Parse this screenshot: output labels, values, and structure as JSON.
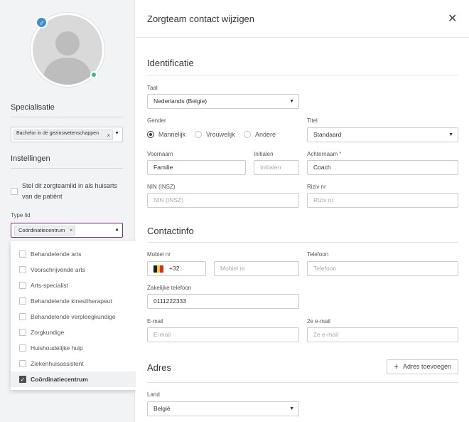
{
  "profile": {
    "gender_icon": "male-symbol-icon",
    "status_color": "#2fbf8f",
    "specialisatie_title": "Specialisatie",
    "specialisatie_value": "Bachelor in de gezinswetenschappen",
    "instellingen_title": "Instellingen",
    "huisarts_label": "Stel dit zorgteamlid in als huisarts van de patiënt",
    "type_lid_label": "Type lid",
    "type_lid_value": "Coördinatiecentrum",
    "type_options": [
      {
        "label": "Behandelende arts",
        "checked": false
      },
      {
        "label": "Voorschrijvende arts",
        "checked": false
      },
      {
        "label": "Arts-specialist",
        "checked": false
      },
      {
        "label": "Behandelende kinesitherapeut",
        "checked": false
      },
      {
        "label": "Behandelende verpleegkundige",
        "checked": false
      },
      {
        "label": "Zorgkundige",
        "checked": false
      },
      {
        "label": "Huishoudelijke hulp",
        "checked": false
      },
      {
        "label": "Ziekenhuisassistent",
        "checked": false
      },
      {
        "label": "Coördinatiecentrum",
        "checked": true
      }
    ],
    "accent_color": "#7c2a7f"
  },
  "dialog": {
    "title": "Zorgteam contact wijzigen",
    "close": "✕"
  },
  "identificatie": {
    "title": "Identificatie",
    "taal_label": "Taal",
    "taal_value": "Nederlands (Belgie)",
    "gender_label": "Gender",
    "gender_options": [
      "Mannelijk",
      "Vrouwelijk",
      "Andere"
    ],
    "gender_selected": "Mannelijk",
    "titel_label": "Titel",
    "titel_value": "Standaard",
    "voornaam_label": "Voornaam",
    "voornaam_value": "Familie",
    "initialen_label": "Initialen",
    "initialen_placeholder": "Initialen",
    "achternaam_label": "Achternaam",
    "achternaam_required": "*",
    "achternaam_value": "Coach",
    "nin_label": "NIN (INSZ)",
    "nin_placeholder": "NIN (INSZ)",
    "riziv_label": "Riziv nr",
    "riziv_placeholder": "Riziv nr"
  },
  "contactinfo": {
    "title": "Contactinfo",
    "mobiel_label": "Mobiel nr",
    "country_code": "+32",
    "mobiel_placeholder": "Mobiel nr",
    "telefoon_label": "Telefoon",
    "telefoon_placeholder": "Telefoon",
    "zakelijk_label": "Zakelijke telefoon",
    "zakelijk_value": "0111222333",
    "email_label": "E-mail",
    "email_placeholder": "E-mail",
    "email2_label": "2e e-mail",
    "email2_placeholder": "2e e-mail"
  },
  "adres": {
    "title": "Adres",
    "add_button": "Adres toevoegen",
    "land_label": "Land",
    "land_value": "België"
  }
}
